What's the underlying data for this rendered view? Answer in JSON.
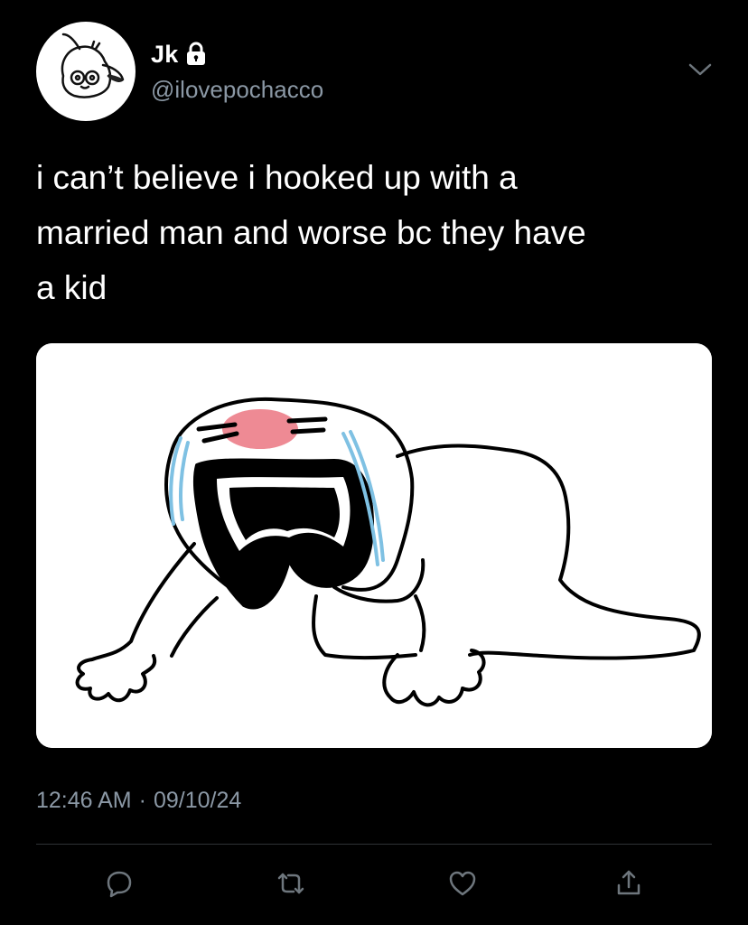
{
  "user": {
    "display_name": "Jk",
    "handle": "@ilovepochacco",
    "avatar_icon": "pochacco-avatar-icon",
    "protected_icon": "lock-icon"
  },
  "tweet": {
    "text": "i can’t believe i hooked up with a\nmarried man and worse bc they have\na kid",
    "time": "12:46 AM",
    "separator": "·",
    "date": "09/10/24"
  },
  "media": {
    "icon": "crying-cartoon-meme-image"
  },
  "actions": [
    {
      "name": "reply",
      "icon": "reply-icon"
    },
    {
      "name": "retweet",
      "icon": "retweet-icon"
    },
    {
      "name": "like",
      "icon": "heart-icon"
    },
    {
      "name": "share",
      "icon": "share-icon"
    }
  ],
  "colors": {
    "background": "#000000",
    "text_primary": "#ffffff",
    "text_secondary": "#8b98a5",
    "divider": "#2f3336"
  }
}
